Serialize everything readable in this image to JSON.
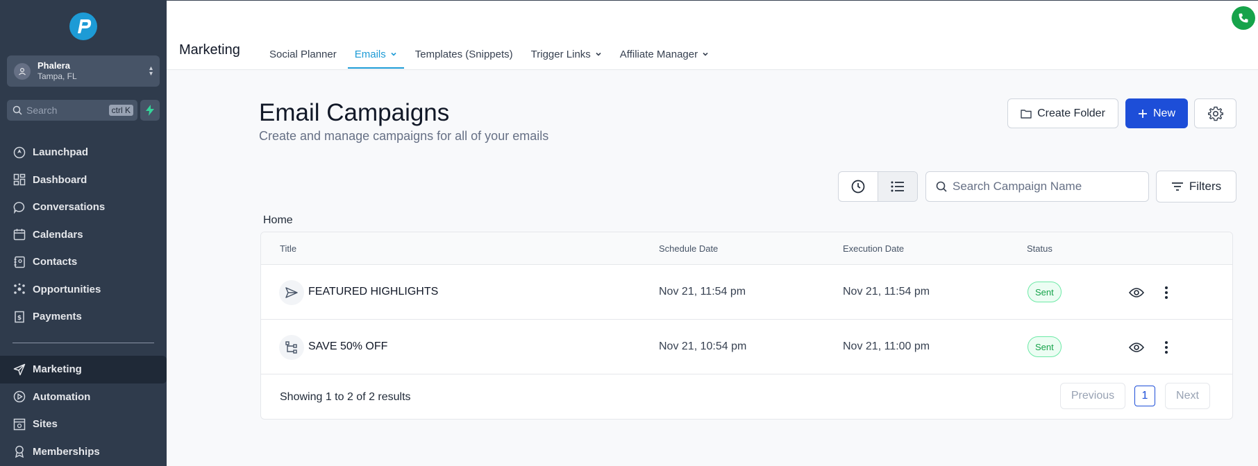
{
  "sidebar": {
    "location": {
      "name": "Phalera",
      "city": "Tampa, FL"
    },
    "search": {
      "placeholder": "Search",
      "shortcut": "ctrl K"
    },
    "items": [
      {
        "label": "Launchpad",
        "icon": "launchpad-icon"
      },
      {
        "label": "Dashboard",
        "icon": "dashboard-icon"
      },
      {
        "label": "Conversations",
        "icon": "chat-icon"
      },
      {
        "label": "Calendars",
        "icon": "calendar-icon"
      },
      {
        "label": "Contacts",
        "icon": "contacts-icon"
      },
      {
        "label": "Opportunities",
        "icon": "opportunities-icon"
      },
      {
        "label": "Payments",
        "icon": "payments-icon"
      }
    ],
    "items2": [
      {
        "label": "Marketing",
        "icon": "send-icon",
        "active": true
      },
      {
        "label": "Automation",
        "icon": "automation-icon"
      },
      {
        "label": "Sites",
        "icon": "sites-icon"
      },
      {
        "label": "Memberships",
        "icon": "award-icon"
      }
    ]
  },
  "topbar": {
    "title": "Marketing",
    "tabs": [
      {
        "label": "Social Planner"
      },
      {
        "label": "Emails",
        "active": true,
        "dropdown": true
      },
      {
        "label": "Templates (Snippets)"
      },
      {
        "label": "Trigger Links",
        "dropdown": true
      },
      {
        "label": "Affiliate Manager",
        "dropdown": true
      }
    ]
  },
  "page": {
    "title": "Email Campaigns",
    "subtitle": "Create and manage campaigns for all of your emails",
    "create_folder_label": "Create Folder",
    "new_label": "New",
    "search_placeholder": "Search Campaign Name",
    "filters_label": "Filters",
    "breadcrumb": "Home"
  },
  "table": {
    "columns": [
      "Title",
      "Schedule Date",
      "Execution Date",
      "Status"
    ],
    "rows": [
      {
        "title": "FEATURED HIGHLIGHTS",
        "schedule": "Nov 21, 11:54 pm",
        "execution": "Nov 21, 11:54 pm",
        "status": "Sent",
        "icon": "send-icon"
      },
      {
        "title": "SAVE 50% OFF",
        "schedule": "Nov 21, 10:54 pm",
        "execution": "Nov 21, 11:00 pm",
        "status": "Sent",
        "icon": "workflow-icon"
      }
    ],
    "footer": {
      "showing": "Showing 1 to 2 of 2 results",
      "previous": "Previous",
      "page": "1",
      "next": "Next"
    }
  },
  "colors": {
    "primary": "#1d4ed8",
    "accent": "#1d9bd6",
    "sidebar": "#2f3b4c",
    "success": "#16a34a"
  }
}
